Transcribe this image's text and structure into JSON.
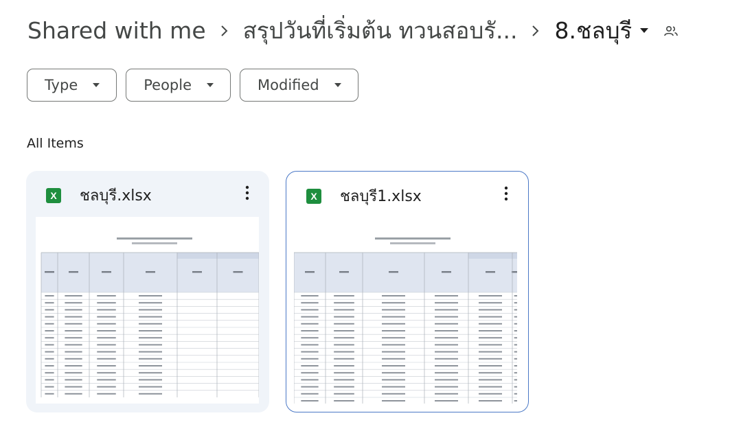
{
  "breadcrumb": {
    "root": "Shared with me",
    "parent": "สรุปวันที่เริ่มต้น ทวนสอบรั...",
    "current": "8.ชลบุรี",
    "current_menu_icon": "caret-down-icon",
    "shared_icon": "people-icon"
  },
  "filters": [
    {
      "label": "Type"
    },
    {
      "label": "People"
    },
    {
      "label": "Modified"
    }
  ],
  "section_label": "All Items",
  "files": [
    {
      "name": "ชลบุรี.xlsx",
      "icon": "sheets-x-icon",
      "icon_letter": "X",
      "selected": false
    },
    {
      "name": "ชลบุรี1.xlsx",
      "icon": "sheets-x-icon",
      "icon_letter": "X",
      "selected": true
    }
  ],
  "colors": {
    "accent_border": "#4a78c6",
    "card_bg": "#f0f4f9",
    "excel_green": "#1e8e3e"
  }
}
